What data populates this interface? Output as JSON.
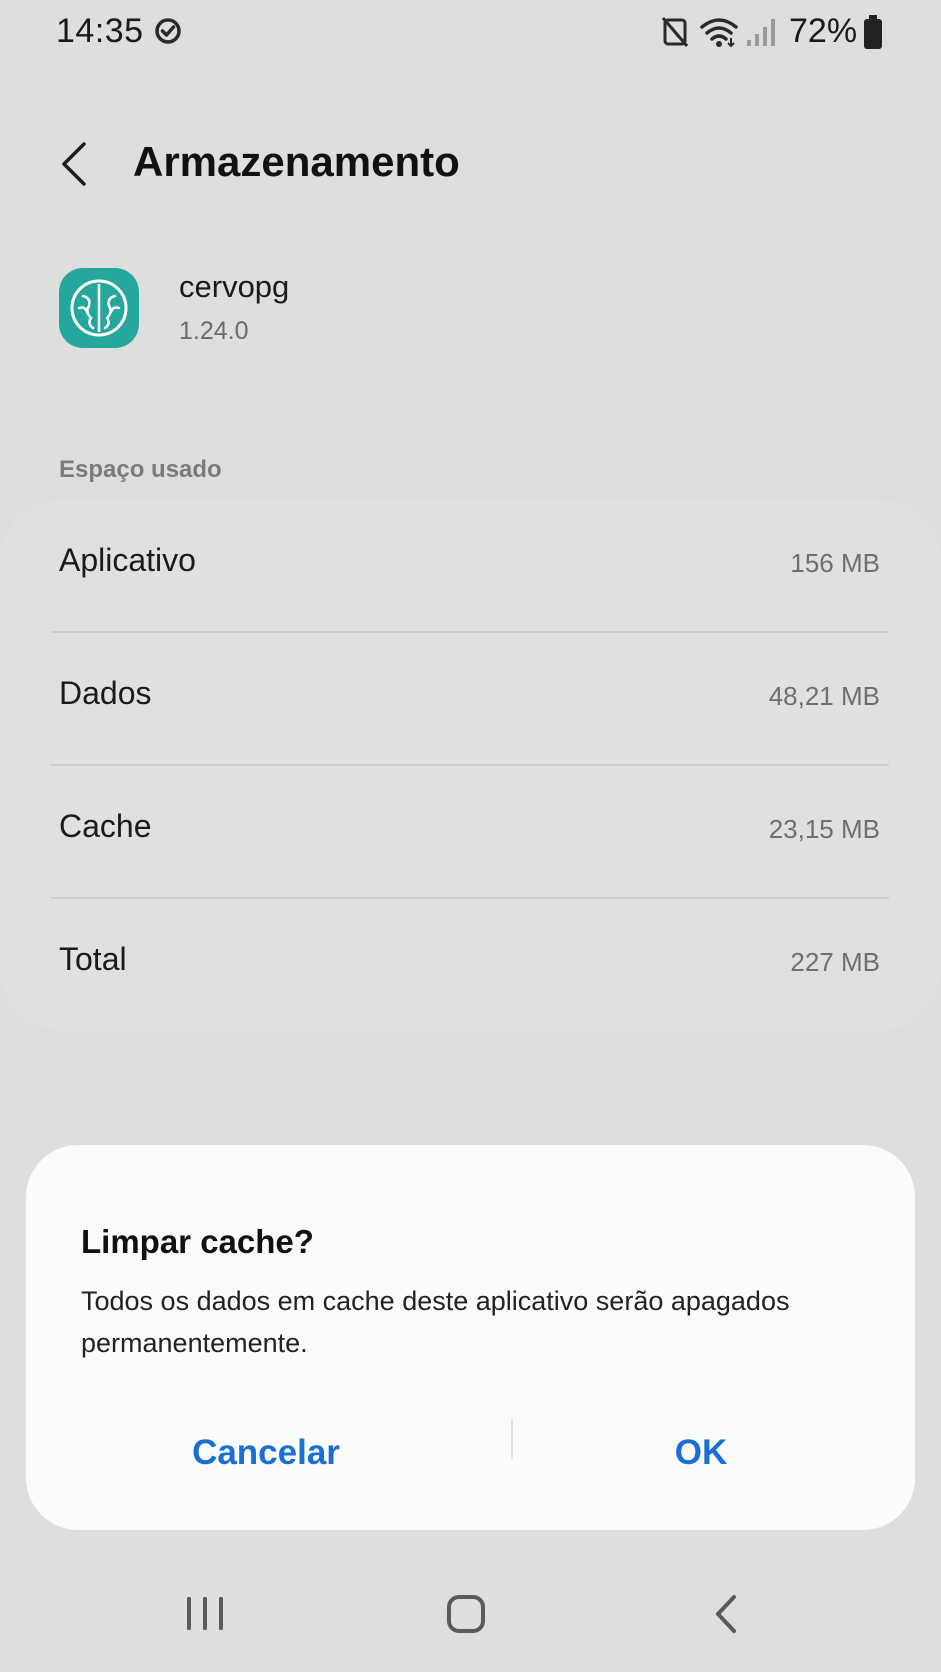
{
  "status_bar": {
    "time": "14:35",
    "battery": "72%",
    "icons": [
      "check-circle-icon",
      "nfc-icon",
      "wifi-icon",
      "signal-icon",
      "battery-icon"
    ]
  },
  "header": {
    "title": "Armazenamento",
    "back_icon": "chevron-left-icon"
  },
  "app": {
    "name": "cervopg",
    "version": "1.24.0",
    "icon": "brain-icon",
    "icon_color": "#26a79b"
  },
  "storage": {
    "section_label": "Espaço usado",
    "rows": [
      {
        "label": "Aplicativo",
        "value": "156 MB"
      },
      {
        "label": "Dados",
        "value": "48,21 MB"
      },
      {
        "label": "Cache",
        "value": "23,15 MB"
      },
      {
        "label": "Total",
        "value": "227 MB"
      }
    ]
  },
  "dialog": {
    "title": "Limpar cache?",
    "message": "Todos os dados em cache deste aplicativo serão apagados permanentemente.",
    "cancel_label": "Cancelar",
    "ok_label": "OK",
    "accent_color": "#1a6fd4"
  },
  "nav_bar": {
    "icons": [
      "recent-apps-icon",
      "home-icon",
      "back-icon"
    ]
  }
}
